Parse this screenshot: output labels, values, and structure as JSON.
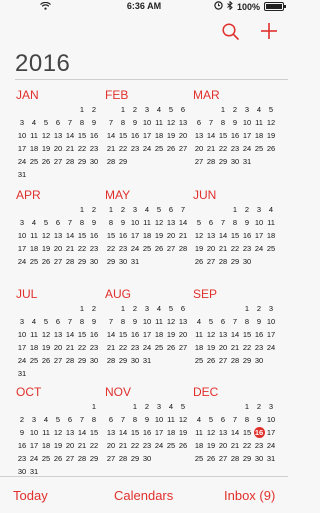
{
  "status_bar": {
    "time": "6:36 AM",
    "battery": "100%",
    "battery_level": 1.0
  },
  "nav": {
    "search_icon": "search-icon",
    "add_icon": "plus-icon"
  },
  "year": "2016",
  "accent_color": "#e0302c",
  "months": [
    {
      "name": "JAN",
      "offset": 5,
      "days": 31
    },
    {
      "name": "FEB",
      "offset": 1,
      "days": 29
    },
    {
      "name": "MAR",
      "offset": 2,
      "days": 31
    },
    {
      "name": "APR",
      "offset": 5,
      "days": 30
    },
    {
      "name": "MAY",
      "offset": 0,
      "days": 31
    },
    {
      "name": "JUN",
      "offset": 3,
      "days": 30
    },
    {
      "name": "JUL",
      "offset": 5,
      "days": 31
    },
    {
      "name": "AUG",
      "offset": 1,
      "days": 31
    },
    {
      "name": "SEP",
      "offset": 4,
      "days": 30
    },
    {
      "name": "OCT",
      "offset": 6,
      "days": 31
    },
    {
      "name": "NOV",
      "offset": 2,
      "days": 30
    },
    {
      "name": "DEC",
      "offset": 4,
      "days": 31,
      "highlight_day": 16
    }
  ],
  "tab_bar": {
    "today": "Today",
    "calendars": "Calendars",
    "inbox": "Inbox (9)"
  }
}
